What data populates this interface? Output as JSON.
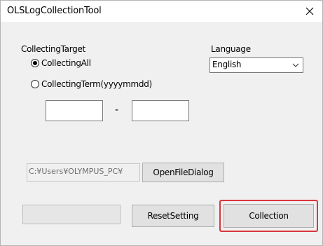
{
  "window": {
    "title": "OLSLogCollectionTool"
  },
  "collecting": {
    "heading": "CollectingTarget",
    "option_all": "CollectingAll",
    "option_term": "CollectingTerm(yyyymmdd)",
    "selected": "all",
    "term_from": "",
    "term_separator": "-",
    "term_to": ""
  },
  "language": {
    "label": "Language",
    "selected": "English"
  },
  "file": {
    "path": "C:¥Users¥OLYMPUS_PC¥",
    "open_dialog_label": "OpenFileDialog"
  },
  "progress": {
    "value": 0
  },
  "buttons": {
    "reset_label": "ResetSetting",
    "collection_label": "Collection"
  },
  "colors": {
    "highlight": "#d9363e"
  },
  "icons": {
    "close": "close-icon",
    "dropdown": "chevron-down-icon"
  }
}
